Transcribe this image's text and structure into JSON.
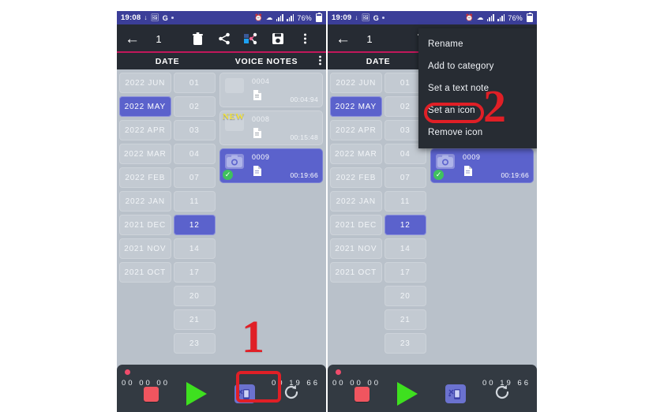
{
  "meta": {
    "app_context": "android-voice-recorder-app",
    "accent_pink": "#c2185b",
    "accent_blue": "#5b62cc",
    "annotation_red": "#e01f26",
    "status_blue": "#3b3e98",
    "toolbar_dark": "#262b33",
    "list_bg": "#b9c1ca",
    "new_badge_yellow": "#f2e33c",
    "check_green": "#3fc15e",
    "play_green": "#3ee01f",
    "stop_red": "#f0555f"
  },
  "screens": [
    {
      "id": "left",
      "statusbar": {
        "clock": "19:08",
        "left_icons": [
          "download-icon",
          "image-icon",
          "google-icon",
          "dot-icon"
        ],
        "google_label": "G",
        "right_icons": [
          "alarm-icon",
          "wifi-icon",
          "signal-icon",
          "signal-icon"
        ],
        "battery": "76%"
      },
      "toolbar": {
        "back_icon": "back-arrow-icon",
        "selected_count": "1",
        "icons": [
          "trash-icon",
          "share-icon",
          "social-share-icon",
          "save-icon",
          "overflow-menu-icon"
        ]
      },
      "columns": {
        "date_label": "DATE",
        "notes_label": "VOICE NOTES",
        "kebab_icon": "overflow-menu-icon"
      },
      "months": [
        {
          "label": "2022 JUN",
          "selected": false
        },
        {
          "label": "2022 MAY",
          "selected": true
        },
        {
          "label": "2022 APR",
          "selected": false
        },
        {
          "label": "2022 MAR",
          "selected": false
        },
        {
          "label": "2022 FEB",
          "selected": false
        },
        {
          "label": "2022 JAN",
          "selected": false
        },
        {
          "label": "2021 DEC",
          "selected": false
        },
        {
          "label": "2021 NOV",
          "selected": false
        },
        {
          "label": "2021 OCT",
          "selected": false
        },
        {
          "label": "",
          "selected": false
        },
        {
          "label": "",
          "selected": false
        },
        {
          "label": "",
          "selected": false
        }
      ],
      "days": [
        {
          "label": "01",
          "selected": false
        },
        {
          "label": "02",
          "selected": false
        },
        {
          "label": "03",
          "selected": false
        },
        {
          "label": "04",
          "selected": false
        },
        {
          "label": "07",
          "selected": false
        },
        {
          "label": "11",
          "selected": false
        },
        {
          "label": "12",
          "selected": true
        },
        {
          "label": "14",
          "selected": false
        },
        {
          "label": "17",
          "selected": false
        },
        {
          "label": "20",
          "selected": false
        },
        {
          "label": "21",
          "selected": false
        },
        {
          "label": "23",
          "selected": false
        }
      ],
      "notes": [
        {
          "id": "0004",
          "duration": "00:04:94",
          "selected": false,
          "is_new": false,
          "checked": false
        },
        {
          "id": "0008",
          "duration": "00:15:48",
          "selected": false,
          "is_new": true,
          "new_label": "NEW",
          "checked": false
        },
        {
          "id": "0009",
          "duration": "00:19:66",
          "selected": true,
          "is_new": false,
          "checked": true
        }
      ],
      "player": {
        "time_left": "00 00 00",
        "time_right": "00 19 66",
        "buttons": [
          "stop-button",
          "play-button",
          "set-icon-button",
          "loop-button"
        ]
      },
      "menu": null
    },
    {
      "id": "right",
      "statusbar": {
        "clock": "19:09",
        "left_icons": [
          "download-icon",
          "image-icon",
          "google-icon",
          "dot-icon"
        ],
        "google_label": "G",
        "right_icons": [
          "alarm-icon",
          "wifi-icon",
          "signal-icon",
          "signal-icon"
        ],
        "battery": "76%"
      },
      "toolbar": {
        "back_icon": "back-arrow-icon",
        "selected_count": "1",
        "icons": [
          "trash-icon"
        ]
      },
      "columns": {
        "date_label": "DATE",
        "notes_label": "",
        "kebab_icon": ""
      },
      "months": [
        {
          "label": "2022 JUN",
          "selected": false
        },
        {
          "label": "2022 MAY",
          "selected": true
        },
        {
          "label": "2022 APR",
          "selected": false
        },
        {
          "label": "2022 MAR",
          "selected": false
        },
        {
          "label": "2022 FEB",
          "selected": false
        },
        {
          "label": "2022 JAN",
          "selected": false
        },
        {
          "label": "2021 DEC",
          "selected": false
        },
        {
          "label": "2021 NOV",
          "selected": false
        },
        {
          "label": "2021 OCT",
          "selected": false
        },
        {
          "label": "",
          "selected": false
        },
        {
          "label": "",
          "selected": false
        },
        {
          "label": "",
          "selected": false
        }
      ],
      "days": [
        {
          "label": "01",
          "selected": false
        },
        {
          "label": "02",
          "selected": false
        },
        {
          "label": "03",
          "selected": false
        },
        {
          "label": "04",
          "selected": false
        },
        {
          "label": "07",
          "selected": false
        },
        {
          "label": "11",
          "selected": false
        },
        {
          "label": "12",
          "selected": true
        },
        {
          "label": "14",
          "selected": false
        },
        {
          "label": "17",
          "selected": false
        },
        {
          "label": "20",
          "selected": false
        },
        {
          "label": "21",
          "selected": false
        },
        {
          "label": "23",
          "selected": false
        }
      ],
      "notes": [
        {
          "id": "",
          "duration": "",
          "selected": false,
          "is_new": false,
          "checked": false,
          "hidden": true
        },
        {
          "id": "",
          "duration": "",
          "selected": false,
          "is_new": false,
          "checked": false,
          "hidden": true
        },
        {
          "id": "0009",
          "duration": "00:19:66",
          "selected": true,
          "is_new": false,
          "checked": true
        }
      ],
      "player": {
        "time_left": "00 00 00",
        "time_right": "00 19 66",
        "buttons": [
          "stop-button",
          "play-button",
          "set-icon-button",
          "loop-button"
        ]
      },
      "menu": {
        "items": [
          {
            "label": "Rename"
          },
          {
            "label": "Add to category"
          },
          {
            "label": "Set a text note"
          },
          {
            "label": "Set an icon"
          },
          {
            "label": "Remove icon"
          }
        ]
      }
    }
  ],
  "annotations": [
    {
      "id": "1",
      "label": "1",
      "target": "set-icon-button"
    },
    {
      "id": "2",
      "label": "2",
      "target": "menu-item-set-an-icon"
    }
  ]
}
